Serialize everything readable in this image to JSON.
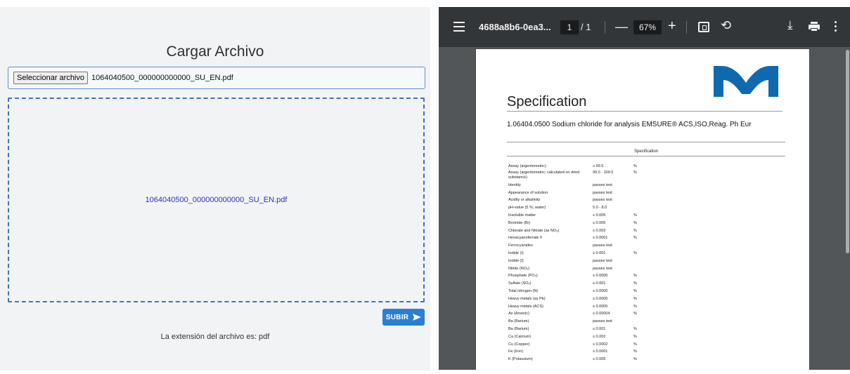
{
  "upload": {
    "title": "Cargar Archivo",
    "file_button": "Seleccionar archivo",
    "file_name": "1064040500_000000000000_SU_EN.pdf",
    "dropzone_text": "1064040500_000000000000_SU_EN.pdf",
    "submit_label": "SUBIR",
    "extension_text": "La extensión del archivo es: pdf"
  },
  "viewer": {
    "doc_title": "4688a8b6-0ea3...",
    "page_current": "1",
    "page_total": "/ 1",
    "zoom": "67%",
    "icons": [
      "menu-icon",
      "zoom-out-icon",
      "zoom-in-icon",
      "fit-page-icon",
      "rotate-icon",
      "download-icon",
      "print-icon",
      "more-icon"
    ]
  },
  "document": {
    "heading": "Specification",
    "product_line": "1.06404.0500    Sodium chloride for analysis EMSURE® ACS,ISO,Reag. Ph Eur",
    "table_header": "Specification",
    "rows": [
      {
        "name": "Assay (argentometric)",
        "value": "≥ 99.5",
        "unit": "%"
      },
      {
        "name": "Assay (argentometric; calculated on dried substance)",
        "value": "99.0 - 100.5",
        "unit": "%"
      },
      {
        "name": "Identity",
        "value": "passes test",
        "unit": ""
      },
      {
        "name": "Appearance of solution",
        "value": "passes test",
        "unit": ""
      },
      {
        "name": "Acidity or alkalinity",
        "value": "passes test",
        "unit": ""
      },
      {
        "name": "pH-value (5  %; water)",
        "value": "5.0 - 8.0",
        "unit": ""
      },
      {
        "name": "Insoluble matter",
        "value": "≤ 0.005",
        "unit": "%"
      },
      {
        "name": "Bromide (Br)",
        "value": "≤ 0.005",
        "unit": "%"
      },
      {
        "name": "Chlorate and Nitrate (as NO₃)",
        "value": "≤ 0.003",
        "unit": "%"
      },
      {
        "name": "Hexacyanoferrate II",
        "value": "≤ 0.0001",
        "unit": "%"
      },
      {
        "name": "Ferrocyanides",
        "value": "passes test",
        "unit": ""
      },
      {
        "name": "Iodide (I)",
        "value": "≤ 0.001",
        "unit": "%"
      },
      {
        "name": "Iodide (I)",
        "value": "passes test",
        "unit": ""
      },
      {
        "name": "Nitrite (NO₂)",
        "value": "passes test",
        "unit": ""
      },
      {
        "name": "Phosphate (PO₄)",
        "value": "≤ 0.0005",
        "unit": "%"
      },
      {
        "name": "Sulfate (SO₄)",
        "value": "≤ 0.001",
        "unit": "%"
      },
      {
        "name": "Total nitrogen (N)",
        "value": "≤ 0.0005",
        "unit": "%"
      },
      {
        "name": "Heavy metals (as Pb)",
        "value": "≤ 0.0005",
        "unit": "%"
      },
      {
        "name": "Heavy metals (ACS)",
        "value": "≤ 0.0005",
        "unit": "%"
      },
      {
        "name": "As (Arsenic)",
        "value": "≤ 0.00004",
        "unit": "%"
      },
      {
        "name": "Ba (Barium)",
        "value": "passes test",
        "unit": ""
      },
      {
        "name": "Ba (Barium)",
        "value": "≤ 0.001",
        "unit": "%"
      },
      {
        "name": "Ca (Calcium)",
        "value": "≤ 0.002",
        "unit": "%"
      },
      {
        "name": "Cu (Copper)",
        "value": "≤ 0.0002",
        "unit": "%"
      },
      {
        "name": "Fe (Iron)",
        "value": "≤ 0.0001",
        "unit": "%"
      },
      {
        "name": "K (Potassium)",
        "value": "≤ 0.005",
        "unit": "%"
      }
    ]
  },
  "colors": {
    "accent_blue": "#2a7fd4",
    "dropzone_border": "#3d73c4",
    "viewer_toolbar": "#323639",
    "logo": "#0f69af"
  }
}
